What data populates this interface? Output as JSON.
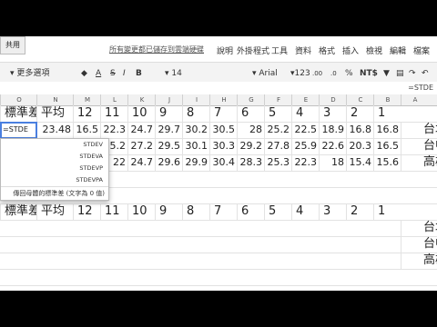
{
  "menu": {
    "items": [
      "檔案",
      "編輯",
      "檢視",
      "插入",
      "格式",
      "資料",
      "工具",
      "外掛程式",
      "說明"
    ],
    "notice": "所有變更都已儲存到雲端硬碟",
    "share": "共用"
  },
  "toolbar": {
    "print_icon": "print-icon",
    "undo_icon": "undo-icon",
    "redo_icon": "redo-icon",
    "paint_icon": "paint-format-icon",
    "currency": "NT$",
    "percent": "%",
    "decimals_less": ".0",
    "decimals_more": ".00",
    "format_more": "123",
    "font": "Arial",
    "font_size": "14",
    "bold": "B",
    "italic": "I",
    "strike": "S",
    "text_color": "A",
    "more": "更多選項"
  },
  "formula_bar": {
    "value": "=STDE"
  },
  "columns": [
    "A",
    "B",
    "C",
    "D",
    "E",
    "F",
    "G",
    "H",
    "I",
    "J",
    "K",
    "L",
    "M",
    "N",
    "O"
  ],
  "header_row": [
    "1",
    "2",
    "3",
    "4",
    "5",
    "6",
    "7",
    "8",
    "9",
    "10",
    "11",
    "12",
    "平均",
    "標準差"
  ],
  "data_rows": [
    {
      "label": "台北",
      "values": [
        "16.8",
        "16.8",
        "18.9",
        "22.5",
        "25.2",
        "28",
        "30.5",
        "30.2",
        "29.7",
        "24.7",
        "22.3",
        "16.5"
      ],
      "avg": "23.48",
      "editing": "=STDE"
    },
    {
      "label": "台中",
      "values": [
        "16.5",
        "20.3",
        "22.6",
        "25.9",
        "27.8",
        "29.2",
        "30.3",
        "30.1",
        "29.5",
        "27.2",
        "25.2",
        ""
      ],
      "avg": "",
      "editing": ""
    },
    {
      "label": "高雄",
      "values": [
        "15.6",
        "15.4",
        "18",
        "22.3",
        "25.3",
        "28.3",
        "30.4",
        "29.9",
        "29.6",
        "24.7",
        "22",
        ""
      ],
      "avg": "",
      "editing": ""
    }
  ],
  "header_row_2": [
    "1",
    "2",
    "3",
    "4",
    "5",
    "6",
    "7",
    "8",
    "9",
    "10",
    "11",
    "12",
    "平均",
    "標準差"
  ],
  "lower_labels": [
    "台北",
    "台中",
    "高雄"
  ],
  "autocomplete": {
    "items": [
      "STDEV",
      "STDEVA",
      "STDEVP",
      "STDEVPA"
    ],
    "description": "傳回母體的標準差 (文字為 0 值)"
  }
}
